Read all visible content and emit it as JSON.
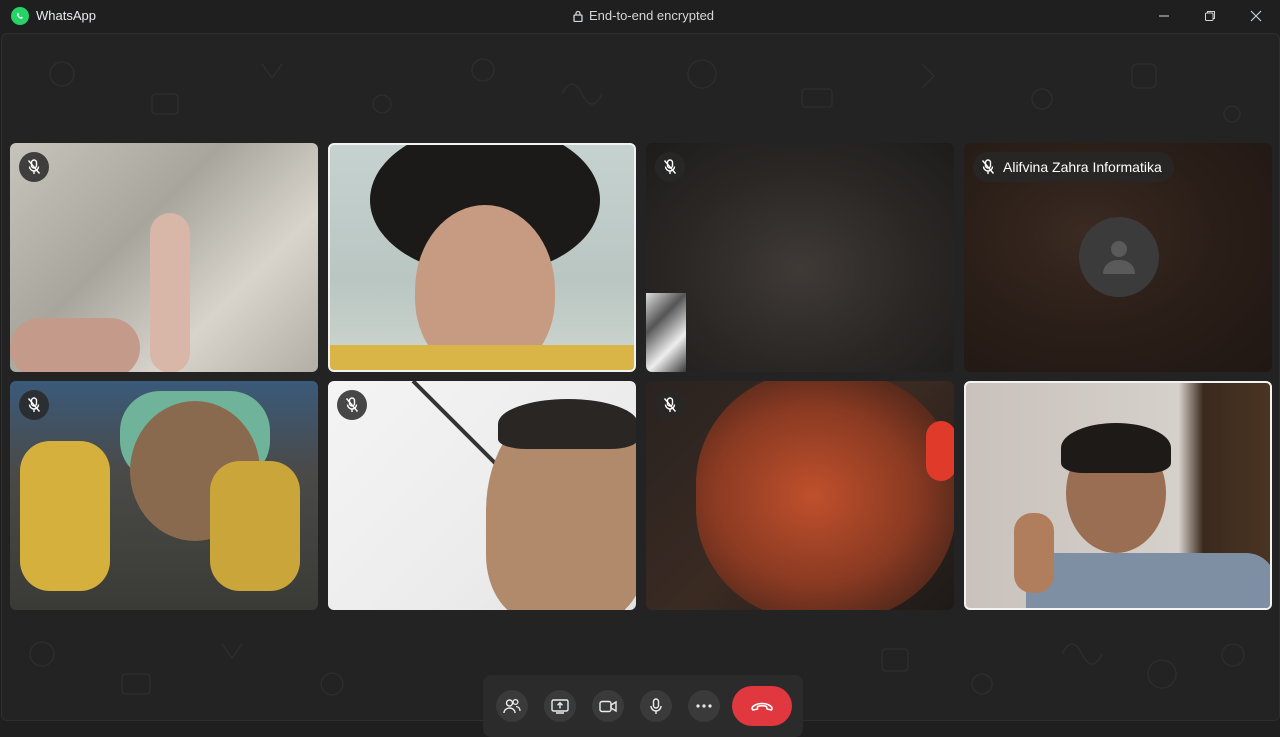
{
  "window": {
    "app_name": "WhatsApp",
    "encryption_label": "End-to-end encrypted"
  },
  "participants": [
    {
      "muted": true
    },
    {
      "muted": false,
      "active_speaker": true
    },
    {
      "muted": true
    },
    {
      "muted": true,
      "name": "Alifvina Zahra Informatika",
      "camera_off": true
    },
    {
      "muted": true
    },
    {
      "muted": true
    },
    {
      "muted": true
    },
    {
      "muted": false,
      "active_speaker": true
    }
  ],
  "controls": {
    "icons": [
      "participants-icon",
      "share-screen-icon",
      "video-camera-icon",
      "microphone-icon",
      "more-options-icon",
      "end-call-icon"
    ]
  },
  "colors": {
    "accent_green": "#25d366",
    "end_call_red": "#e0383e",
    "background": "#1f1f1f"
  }
}
